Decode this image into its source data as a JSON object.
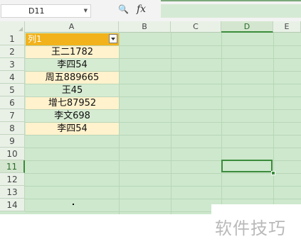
{
  "formula_bar": {
    "name_box": "D11",
    "fx_label": "fx",
    "formula_value": ""
  },
  "columns": [
    "A",
    "B",
    "C",
    "D",
    "E"
  ],
  "active_column": "D",
  "rows": [
    "1",
    "2",
    "3",
    "4",
    "5",
    "6",
    "7",
    "8",
    "9",
    "10",
    "11",
    "12",
    "13",
    "14"
  ],
  "active_row": "11",
  "table": {
    "header": "列1",
    "values": [
      "王二1782",
      "李四54",
      "周五889665",
      "王45",
      "增七87952",
      "李文698",
      "李四54"
    ]
  },
  "watermark": "软件技巧"
}
